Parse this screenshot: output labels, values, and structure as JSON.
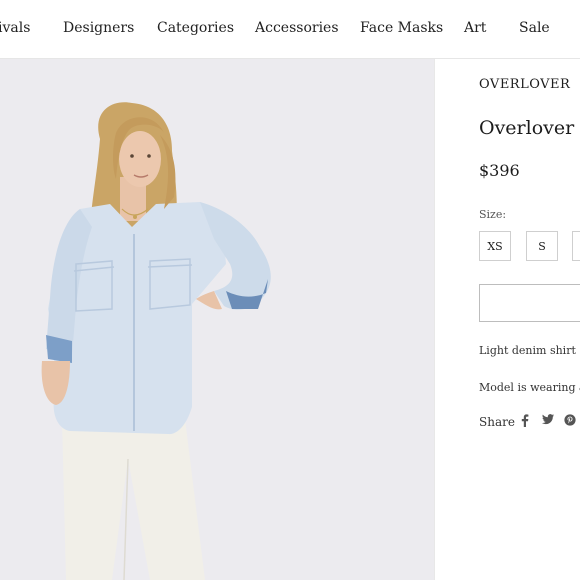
{
  "nav": {
    "items": [
      "ivals",
      "Designers",
      "Categories",
      "Accessories",
      "Face Masks",
      "Art",
      "Sale"
    ]
  },
  "product": {
    "brand": "OVERLOVER",
    "title": "Overlover D",
    "price": "$396",
    "size_label": "Size:",
    "sizes": [
      "XS",
      "S"
    ],
    "description": "Light denim shirt",
    "model_note": "Model is wearing an",
    "share_label": "Share"
  },
  "social_icons": [
    "facebook-icon",
    "twitter-icon",
    "pinterest-icon"
  ],
  "colors": {
    "background": "#ffffff",
    "hero_background": "#ecebef",
    "text": "#1c1c1c",
    "border": "#e6e6e6"
  }
}
